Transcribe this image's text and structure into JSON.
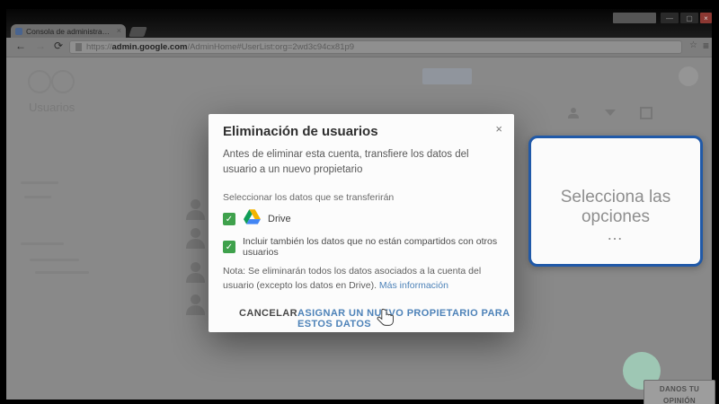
{
  "window": {
    "tab_title": "Consola de administra…",
    "tab_close": "×",
    "controls": {
      "minimize": "—",
      "maximize": "▢",
      "close": "×"
    }
  },
  "toolbar": {
    "back": "←",
    "forward": "→",
    "reload": "⟳",
    "url": {
      "scheme": "https://",
      "domain": "admin.google.com",
      "path": "/AdminHome#UserList:org=2wd3c94cx81p9"
    },
    "bookmark": "☆",
    "menu": "≡"
  },
  "page": {
    "heading": "Usuarios"
  },
  "dialog": {
    "title": "Eliminación de usuarios",
    "close": "×",
    "body": "Antes de eliminar esta cuenta, transfiere los datos del usuario a un nuevo propietario",
    "select_label": "Seleccionar los datos que se transferirán",
    "check_glyph": "✓",
    "checkboxes": [
      {
        "label": "Drive",
        "checked": true
      },
      {
        "label": "Incluir también los datos que no están compartidos con otros usuarios",
        "checked": true
      }
    ],
    "note": "Nota: Se eliminarán todos los datos asociados a la cuenta del usuario (excepto los datos en Drive).",
    "note_link": "Más información",
    "cancel_label": "CANCELAR",
    "assign_label": "ASIGNAR UN NUEVO PROPIETARIO PARA ESTOS DATOS"
  },
  "callout": {
    "text": "Selecciona las opciones",
    "dots": "…"
  },
  "feedback": {
    "line1": "DANOS TU",
    "line2": "OPINIÓN"
  },
  "colors": {
    "checkbox_green": "#3fa14c",
    "link_blue": "#4d82b8",
    "cancel_grey": "#474747",
    "callout_border": "#2059a8",
    "close_button_red": "#8c3832",
    "drive_green": "#0f9d58",
    "drive_yellow": "#f4b400",
    "drive_blue": "#4285f4"
  }
}
